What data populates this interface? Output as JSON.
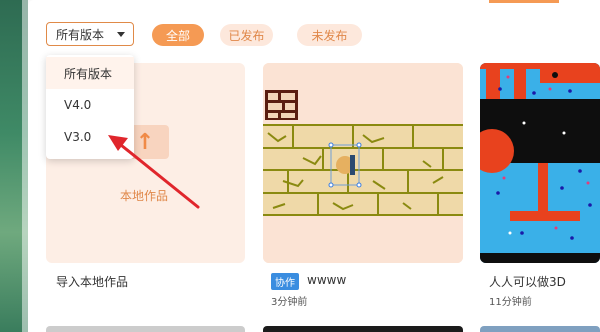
{
  "filters": {
    "version_select": "所有版本",
    "pills": [
      "全部",
      "已发布",
      "未发布"
    ]
  },
  "dropdown": {
    "options": [
      "所有版本",
      "V4.0",
      "V3.0"
    ]
  },
  "cards": [
    {
      "upload_label": "本地作品",
      "title": "导入本地作品"
    },
    {
      "tag": "协作",
      "title": "wwww",
      "time": "3分钟前"
    },
    {
      "title": "人人可以做3D",
      "time": "11分钟前"
    }
  ],
  "colors": {
    "accent": "#f59a54",
    "pill_inactive_bg": "#fde8dc",
    "annotation": "#e0262c",
    "tag_blue": "#3a8de0"
  }
}
